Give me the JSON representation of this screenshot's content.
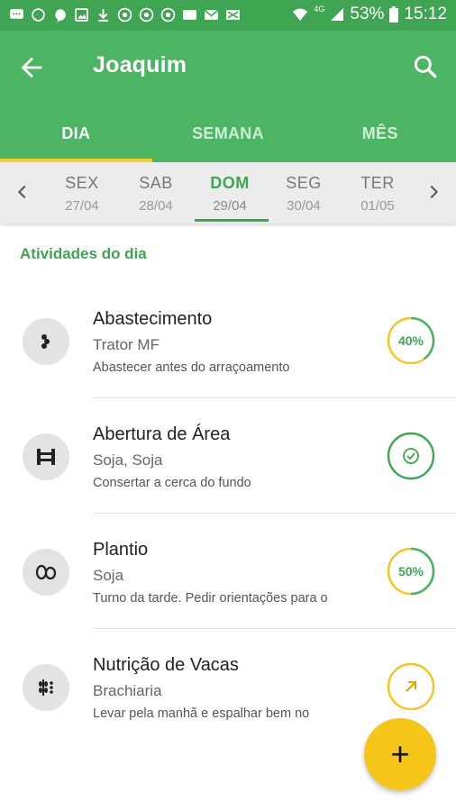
{
  "status_bar": {
    "battery": "53%",
    "time": "15:12",
    "network": "4G"
  },
  "app_bar": {
    "title": "Joaquim"
  },
  "tabs": [
    {
      "label": "DIA"
    },
    {
      "label": "SEMANA"
    },
    {
      "label": "MÊS"
    }
  ],
  "days": [
    {
      "name": "SEX",
      "date": "27/04"
    },
    {
      "name": "SAB",
      "date": "28/04"
    },
    {
      "name": "DOM",
      "date": "29/04"
    },
    {
      "name": "SEG",
      "date": "30/04"
    },
    {
      "name": "TER",
      "date": "01/05"
    }
  ],
  "section_title": "Atividades do dia",
  "activities": [
    {
      "name": "Abastecimento",
      "subtitle": "Trator MF",
      "description": "Abastecer antes do arraçoamento",
      "status": "40%",
      "progress": 0.4,
      "icon": "fuel-icon"
    },
    {
      "name": "Abertura de Área",
      "subtitle": "Soja, Soja",
      "description": "Consertar a cerca do fundo",
      "status": "done",
      "icon": "fence-icon"
    },
    {
      "name": "Plantio",
      "subtitle": "Soja",
      "description": "Turno da tarde. Pedir orientações para o",
      "status": "50%",
      "progress": 0.5,
      "icon": "seeds-icon"
    },
    {
      "name": "Nutrição de Vacas",
      "subtitle": "Brachiaria",
      "description": "Levar pela manhã e espalhar bem no",
      "status": "pending",
      "icon": "grain-icon"
    }
  ],
  "fab": {
    "label": "+"
  },
  "colors": {
    "primary": "#4cb564",
    "accent": "#f5c518",
    "text_green": "#3fa552"
  }
}
